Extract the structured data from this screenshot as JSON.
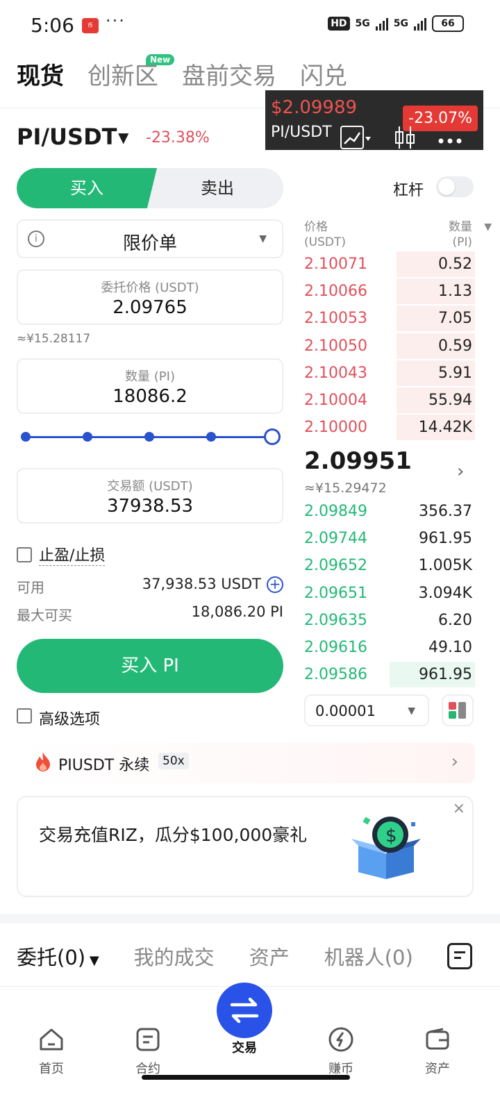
{
  "status_bar": {
    "time": "5:06",
    "app_badge": "币",
    "dots": "···",
    "hd": "HD",
    "net1": "5G",
    "net2": "5G",
    "battery": "66"
  },
  "top_tabs": [
    {
      "label": "现货",
      "active": true
    },
    {
      "label": "创新区",
      "active": false
    },
    {
      "label": "盘前交易",
      "active": false
    },
    {
      "label": "闪兑",
      "active": false
    }
  ],
  "new_badge": "New",
  "float_card": {
    "price": "$2.09989",
    "pair": "PI/USDT",
    "change": "-23.07%"
  },
  "pair": {
    "title": "PI/USDT",
    "change": "-23.38%"
  },
  "trade_tabs": {
    "buy": "买入",
    "sell": "卖出"
  },
  "leverage_label": "杠杆",
  "order_type": {
    "label": "限价单",
    "info_icon": "i"
  },
  "price_field": {
    "label": "委托价格 (USDT)",
    "value": "2.09765"
  },
  "approx_cny": "≈¥15.28117",
  "qty_field": {
    "label": "数量 (PI)",
    "value": "18086.2"
  },
  "slider": {
    "value_percent": 100
  },
  "amount_field": {
    "label": "交易额 (USDT)",
    "value": "37938.53"
  },
  "tpsl_label": "止盈/止损",
  "available": {
    "label": "可用",
    "value": "37,938.53 USDT"
  },
  "max_buy": {
    "label": "最大可买",
    "value": "18,086.20 PI"
  },
  "buy_button": "买入 PI",
  "advanced_label": "高级选项",
  "orderbook": {
    "header": {
      "price": "价格",
      "price_unit": "(USDT)",
      "qty": "数量",
      "qty_unit": "(PI)"
    },
    "asks": [
      {
        "price": "2.10071",
        "qty": "0.52",
        "depth": 0.46
      },
      {
        "price": "2.10066",
        "qty": "1.13",
        "depth": 0.46
      },
      {
        "price": "2.10053",
        "qty": "7.05",
        "depth": 0.46
      },
      {
        "price": "2.10050",
        "qty": "0.59",
        "depth": 0.46
      },
      {
        "price": "2.10043",
        "qty": "5.91",
        "depth": 0.46
      },
      {
        "price": "2.10004",
        "qty": "55.94",
        "depth": 0.46
      },
      {
        "price": "2.10000",
        "qty": "14.42K",
        "depth": 0.46
      }
    ],
    "mid_price": "2.09951",
    "mid_approx": "≈¥15.29472",
    "bids": [
      {
        "price": "2.09849",
        "qty": "356.37",
        "depth": 0
      },
      {
        "price": "2.09744",
        "qty": "961.95",
        "depth": 0
      },
      {
        "price": "2.09652",
        "qty": "1.005K",
        "depth": 0
      },
      {
        "price": "2.09651",
        "qty": "3.094K",
        "depth": 0
      },
      {
        "price": "2.09635",
        "qty": "6.20",
        "depth": 0
      },
      {
        "price": "2.09616",
        "qty": "49.10",
        "depth": 0
      },
      {
        "price": "2.09586",
        "qty": "961.95",
        "depth": 0.5
      }
    ],
    "precision": "0.00001"
  },
  "perp_banner": {
    "label": "PIUSDT 永续",
    "leverage": "50x"
  },
  "promo": {
    "text": "交易充值RIZ，瓜分$100,000豪礼",
    "close": "×"
  },
  "bottom_tabs": [
    {
      "label": "委托(0)",
      "active": true
    },
    {
      "label": "我的成交",
      "active": false
    },
    {
      "label": "资产",
      "active": false
    },
    {
      "label": "机器人(0)",
      "active": false
    }
  ],
  "nav": [
    {
      "label": "首页",
      "icon": "home-icon"
    },
    {
      "label": "合约",
      "icon": "contract-icon"
    },
    {
      "label": "交易",
      "icon": "trade-swap-icon"
    },
    {
      "label": "赚币",
      "icon": "earn-icon"
    },
    {
      "label": "资产",
      "icon": "wallet-icon"
    }
  ],
  "colors": {
    "buy": "#24b877",
    "sell": "#e0505b",
    "accent": "#2952cc"
  }
}
